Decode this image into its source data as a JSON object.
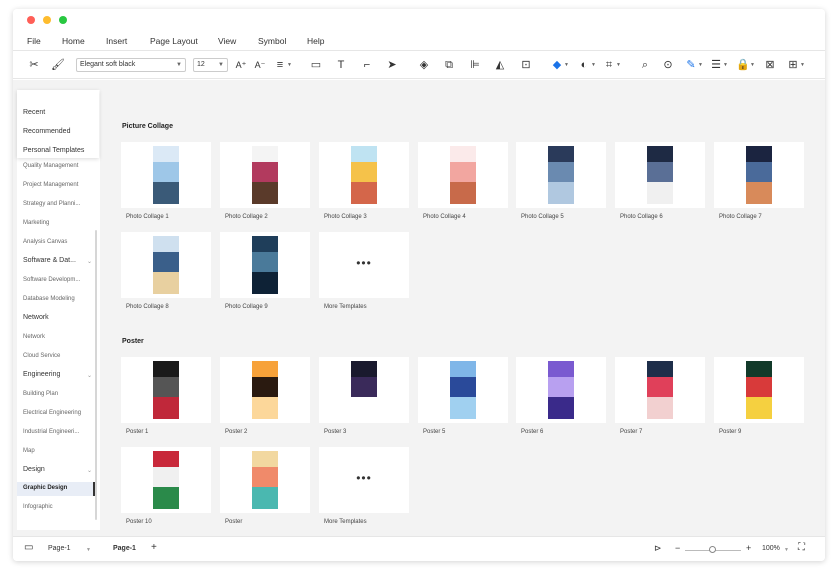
{
  "window": {
    "dots": [
      "#ff5f57",
      "#febc2e",
      "#28c840"
    ]
  },
  "menu": [
    "File",
    "Home",
    "Insert",
    "Page Layout",
    "View",
    "Symbol",
    "Help"
  ],
  "toolbar": {
    "font_family": "Elegant soft black",
    "font_size": "12",
    "icons": [
      "cut-icon",
      "format-painter-icon",
      "increase-font-icon",
      "decrease-font-icon",
      "align-icon",
      "rectangle-icon",
      "text-icon",
      "connector-icon",
      "select-icon",
      "layers-icon",
      "group-icon",
      "align-left-icon",
      "flip-icon",
      "frame-icon",
      "fill-icon",
      "shape-style-icon",
      "crop-icon",
      "search-icon",
      "find-replace-icon",
      "line-color-icon",
      "line-style-icon",
      "lock-icon",
      "fit-icon",
      "more-icon"
    ]
  },
  "sidebar": {
    "popup_items": [
      "Recent",
      "Recommended",
      "Personal Templates"
    ],
    "items": [
      {
        "label": "Quality Management",
        "type": "sub"
      },
      {
        "label": "Project Management",
        "type": "sub"
      },
      {
        "label": "Strategy and Planni...",
        "type": "sub"
      },
      {
        "label": "Marketing",
        "type": "sub"
      },
      {
        "label": "Analysis Canvas",
        "type": "sub"
      },
      {
        "label": "Software & Dat...",
        "type": "cat"
      },
      {
        "label": "Software Developm...",
        "type": "sub"
      },
      {
        "label": "Database Modeling",
        "type": "sub"
      },
      {
        "label": "Network",
        "type": "cat"
      },
      {
        "label": "Network",
        "type": "sub"
      },
      {
        "label": "Cloud Service",
        "type": "sub"
      },
      {
        "label": "Engineering",
        "type": "cat"
      },
      {
        "label": "Building Plan",
        "type": "sub"
      },
      {
        "label": "Electrical Engineering",
        "type": "sub"
      },
      {
        "label": "Industrial Engineeri...",
        "type": "sub"
      },
      {
        "label": "Map",
        "type": "sub"
      },
      {
        "label": "Design",
        "type": "cat"
      },
      {
        "label": "Graphic Design",
        "type": "selected"
      },
      {
        "label": "Infographic",
        "type": "sub"
      }
    ]
  },
  "sections": [
    {
      "title": "Picture Collage",
      "cards": [
        {
          "label": "Photo Collage 1",
          "colors": [
            "#dbe9f6",
            "#9ec7e8",
            "#3a5a78"
          ]
        },
        {
          "label": "Photo Collage 2",
          "colors": [
            "#f4f4f4",
            "#b23a5e",
            "#5a3a2a"
          ]
        },
        {
          "label": "Photo Collage 3",
          "colors": [
            "#bfe3f2",
            "#f5c24a",
            "#d4664a"
          ]
        },
        {
          "label": "Photo Collage 4",
          "colors": [
            "#fbeaea",
            "#f2a6a0",
            "#c86a4a"
          ]
        },
        {
          "label": "Photo Collage 5",
          "colors": [
            "#2a3a5a",
            "#6a8ab0",
            "#b0c8e0"
          ]
        },
        {
          "label": "Photo Collage 6",
          "colors": [
            "#1e2a44",
            "#5a6f96",
            "#f0f0f0"
          ]
        },
        {
          "label": "Photo Collage 7",
          "colors": [
            "#1b2440",
            "#4a6a9a",
            "#d88a5a"
          ]
        },
        {
          "label": "Photo Collage 8",
          "colors": [
            "#cfe0ef",
            "#3a5f8a",
            "#e8d0a0"
          ]
        },
        {
          "label": "Photo Collage 9",
          "colors": [
            "#1f3e5a",
            "#4a7a9a",
            "#0e2236"
          ]
        },
        {
          "label": "More Templates",
          "more": true
        }
      ]
    },
    {
      "title": "Poster",
      "cards": [
        {
          "label": "Poster 1",
          "colors": [
            "#1a1a1a",
            "#555555",
            "#c0283a"
          ]
        },
        {
          "label": "Poster 2",
          "colors": [
            "#f7a23a",
            "#2a1a10",
            "#fcd79a"
          ]
        },
        {
          "label": "Poster 3",
          "colors": [
            "#1a1a2e",
            "#3a2a5a",
            "#ffffff"
          ]
        },
        {
          "label": "Poster 5",
          "colors": [
            "#7fb6e8",
            "#2a4a9a",
            "#a0d0f0"
          ]
        },
        {
          "label": "Poster 6",
          "colors": [
            "#7a5ad0",
            "#b8a0f0",
            "#3a2a8a"
          ]
        },
        {
          "label": "Poster 7",
          "colors": [
            "#1e2e4a",
            "#e0405a",
            "#f2d0d0"
          ]
        },
        {
          "label": "Poster 9",
          "colors": [
            "#123a2a",
            "#d83a3a",
            "#f5d040"
          ]
        },
        {
          "label": "Poster 10",
          "colors": [
            "#c8283a",
            "#f0f0f0",
            "#2a8a4a"
          ]
        },
        {
          "label": "Poster",
          "colors": [
            "#f2d8a0",
            "#f08a6a",
            "#4ab8b0"
          ]
        },
        {
          "label": "More Templates",
          "more": true
        }
      ]
    }
  ],
  "more_dots": "•••",
  "statusbar": {
    "page_select": "Page-1",
    "page_tab": "Page-1",
    "add": "+",
    "zoom_minus": "−",
    "zoom_plus": "+",
    "zoom_level": "100%",
    "zoom_fraction": 0.5
  }
}
